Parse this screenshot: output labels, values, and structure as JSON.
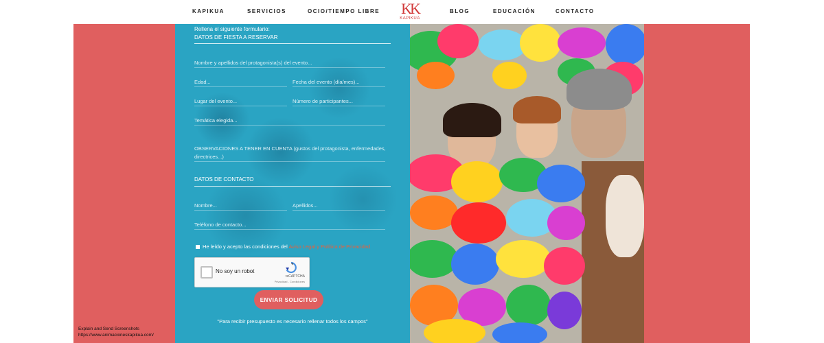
{
  "nav": {
    "items_left": [
      "KAPIKUA",
      "SERVICIOS",
      "OCIO/TIEMPO LIBRE"
    ],
    "items_right": [
      "BLOG",
      "EDUCACIÓN",
      "CONTACTO"
    ],
    "logo_mark": "KK",
    "logo_text": "KAPIKUA"
  },
  "form": {
    "intro": "Rellena el siguiente formulario:",
    "section_party": "DATOS DE FIESTA A RESERVAR",
    "fields": {
      "protagonist": "Nombre y apellidos del protagonista(s) del evento...",
      "age": "Edad...",
      "date": "Fecha del evento (día/mes)...",
      "place": "Lugar del evento...",
      "participants": "Número de participantes...",
      "theme": "Temática elegida...",
      "observations": "OBSERVACIONES A TENER EN CUENTA (gustos del protagonista, enfermedades,",
      "observations_2": "directrices...)",
      "name": "Nombre...",
      "surname": "Apellidos...",
      "phone": "Teléfono de contacto..."
    },
    "section_contact": "DATOS DE CONTACTO",
    "consent_text": "He leído y acepto las condiciones del",
    "consent_link": "Aviso Legal y Política de Privacidad",
    "captcha_label": "No soy un robot",
    "captcha_brand": "reCAPTCHA",
    "captcha_terms": "Privacidad - Condiciones",
    "submit_label": "ENVIAR SOLICITUD",
    "note": "\"Para recibir presupuesto es necesario rellenar todos los campos\""
  },
  "watermark": {
    "line1": "Explain and Send Screenshots",
    "line2": "https://www.animacioneskapikua.com/"
  },
  "colors": {
    "accent": "#e05f5f",
    "panel": "#2aa4c3",
    "link": "#e8603c"
  }
}
